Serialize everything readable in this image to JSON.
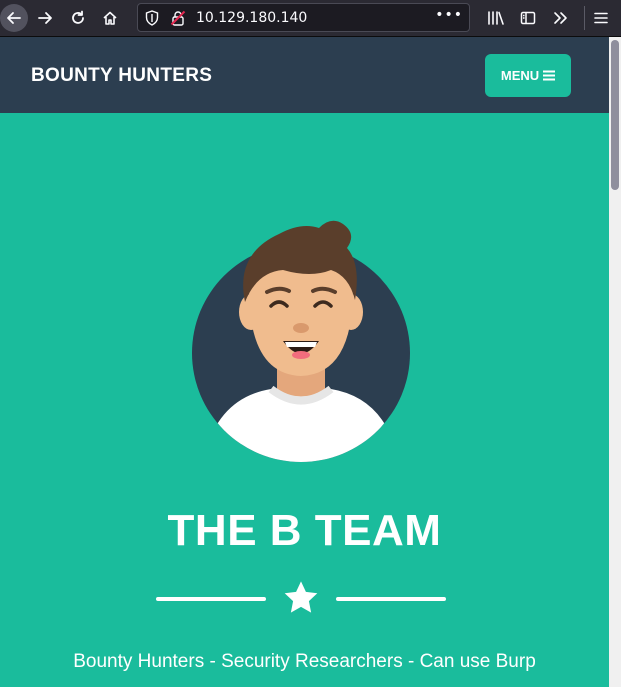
{
  "browser": {
    "url": "10.129.180.140",
    "page_actions": "•••",
    "icons": [
      "back-arrow-icon",
      "forward-arrow-icon",
      "reload-icon",
      "home-icon",
      "shield-icon",
      "insecure-lock-icon",
      "library-icon",
      "sidebar-icon",
      "overflow-chevrons-icon",
      "hamburger-menu-icon"
    ]
  },
  "navbar": {
    "brand": "BOUNTY HUNTERS",
    "menu_label": "MENU"
  },
  "masthead": {
    "heading": "THE B TEAM",
    "subheading": "Bounty Hunters - Security Researchers - Can use Burp"
  },
  "colors": {
    "primary": "#1abc9c",
    "navbar": "#2c3e50",
    "white": "#ffffff"
  }
}
